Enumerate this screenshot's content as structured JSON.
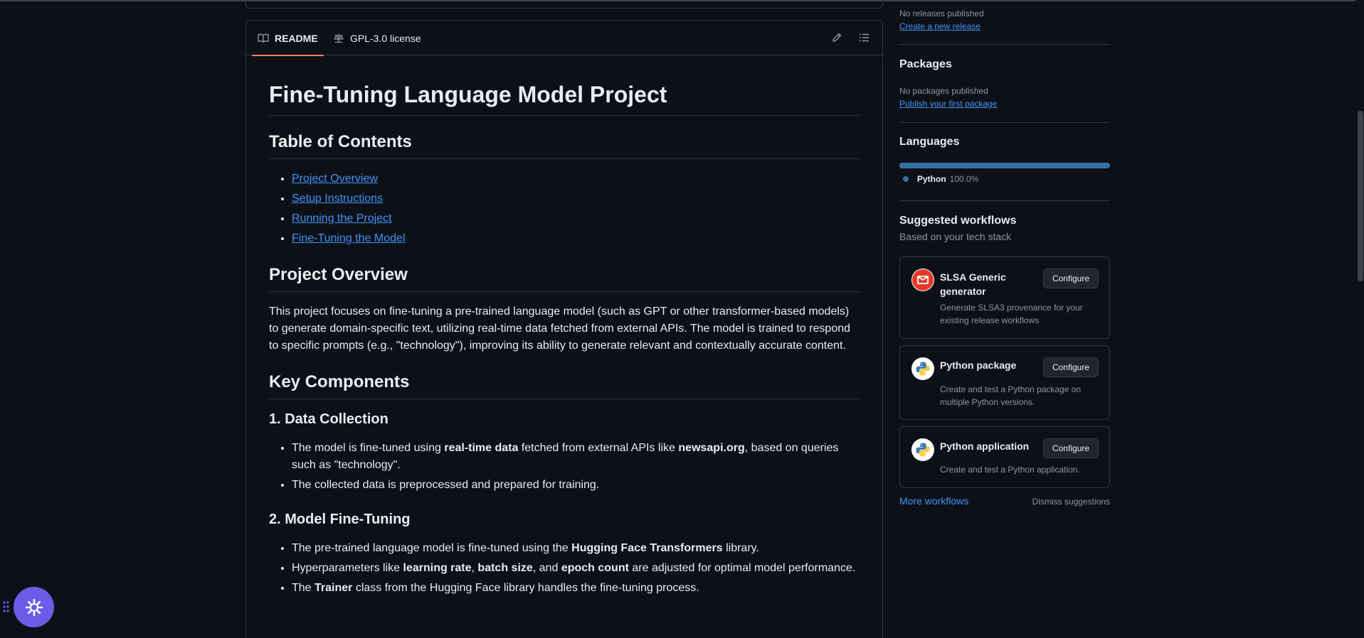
{
  "readme_tabs": {
    "readme_label": "README",
    "license_label": "GPL-3.0 license"
  },
  "readme": {
    "title": "Fine-Tuning Language Model Project",
    "toc_heading": "Table of Contents",
    "toc_links": [
      "Project Overview",
      "Setup Instructions",
      "Running the Project",
      "Fine-Tuning the Model"
    ],
    "overview_heading": "Project Overview",
    "overview_text": "This project focuses on fine-tuning a pre-trained language model (such as GPT or other transformer-based models) to generate domain-specific text, utilizing real-time data fetched from external APIs. The model is trained to respond to specific prompts (e.g., \"technology\"), improving its ability to generate relevant and contextually accurate content.",
    "key_components_heading": "Key Components",
    "data_collection_heading": "1. Data Collection",
    "dc_item1": {
      "t1": "The model is fine-tuned using ",
      "b1": "real-time data",
      "t2": " fetched from external APIs like ",
      "b2": "newsapi.org",
      "t3": ", based on queries such as \"technology\"."
    },
    "dc_item2": "The collected data is preprocessed and prepared for training.",
    "fine_tuning_heading": "2. Model Fine-Tuning",
    "ft_item1": {
      "t1": "The pre-trained language model is fine-tuned using the ",
      "b1": "Hugging Face Transformers",
      "t2": " library."
    },
    "ft_item2": {
      "t1": "Hyperparameters like ",
      "b1": "learning rate",
      "t2": ", ",
      "b2": "batch size",
      "t3": ", and ",
      "b3": "epoch count",
      "t4": " are adjusted for optimal model performance."
    },
    "ft_item3": {
      "t1": "The ",
      "b1": "Trainer",
      "t2": " class from the Hugging Face library handles the fine-tuning process."
    }
  },
  "sidebar": {
    "releases_status": "No releases published",
    "releases_link": "Create a new release",
    "packages_heading": "Packages",
    "packages_status": "No packages published",
    "packages_link": "Publish your first package",
    "languages_heading": "Languages",
    "language_name": "Python",
    "language_percent": "100.0%",
    "language_color": "#3572a5",
    "workflows_heading": "Suggested workflows",
    "workflows_subheading": "Based on your tech stack",
    "workflows": [
      {
        "title": "SLSA Generic generator",
        "desc": "Generate SLSA3 provenance for your existing release workflows",
        "button": "Configure",
        "icon": "slsa-logo-icon"
      },
      {
        "title": "Python package",
        "desc": "Create and test a Python package on multiple Python versions.",
        "button": "Configure",
        "icon": "python-logo-icon"
      },
      {
        "title": "Python application",
        "desc": "Create and test a Python application.",
        "button": "Configure",
        "icon": "python-logo-icon"
      }
    ],
    "more_workflows": "More workflows",
    "dismiss": "Dismiss suggestions"
  },
  "colors": {
    "background": "#0d1117",
    "link": "#4493f8",
    "tab_underline": "#f78166",
    "launcher": "#6b5ce7"
  }
}
